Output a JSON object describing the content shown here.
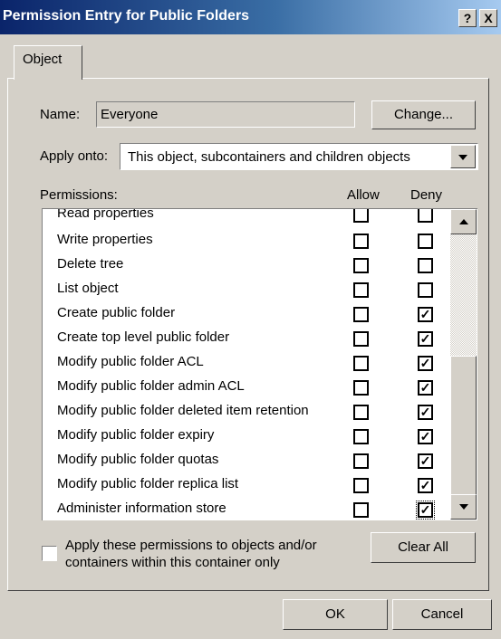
{
  "window": {
    "title": "Permission Entry for Public Folders",
    "help_button": "?",
    "close_button": "X"
  },
  "tabs": [
    {
      "label": "Object"
    }
  ],
  "name": {
    "label": "Name:",
    "value": "Everyone",
    "change_button": "Change..."
  },
  "apply_onto": {
    "label": "Apply onto:",
    "selected": "This object, subcontainers and children objects"
  },
  "permissions": {
    "label": "Permissions:",
    "allow_header": "Allow",
    "deny_header": "Deny",
    "items": [
      {
        "name": "Read properties",
        "allow": false,
        "deny": false
      },
      {
        "name": "Write properties",
        "allow": false,
        "deny": false
      },
      {
        "name": "Delete tree",
        "allow": false,
        "deny": false
      },
      {
        "name": "List object",
        "allow": false,
        "deny": false
      },
      {
        "name": "Create public folder",
        "allow": false,
        "deny": true
      },
      {
        "name": "Create top level public folder",
        "allow": false,
        "deny": true
      },
      {
        "name": "Modify public folder ACL",
        "allow": false,
        "deny": true
      },
      {
        "name": "Modify public folder admin ACL",
        "allow": false,
        "deny": true
      },
      {
        "name": "Modify public folder deleted item retention",
        "allow": false,
        "deny": true
      },
      {
        "name": "Modify public folder expiry",
        "allow": false,
        "deny": true
      },
      {
        "name": "Modify public folder quotas",
        "allow": false,
        "deny": true
      },
      {
        "name": "Modify public folder replica list",
        "allow": false,
        "deny": true
      },
      {
        "name": "Administer information store",
        "allow": false,
        "deny": true
      }
    ]
  },
  "apply_checkbox": {
    "label_line1": "Apply these permissions to objects and/or",
    "label_line2": "containers within this container only",
    "checked": false
  },
  "clear_all_button": "Clear All",
  "ok_button": "OK",
  "cancel_button": "Cancel"
}
